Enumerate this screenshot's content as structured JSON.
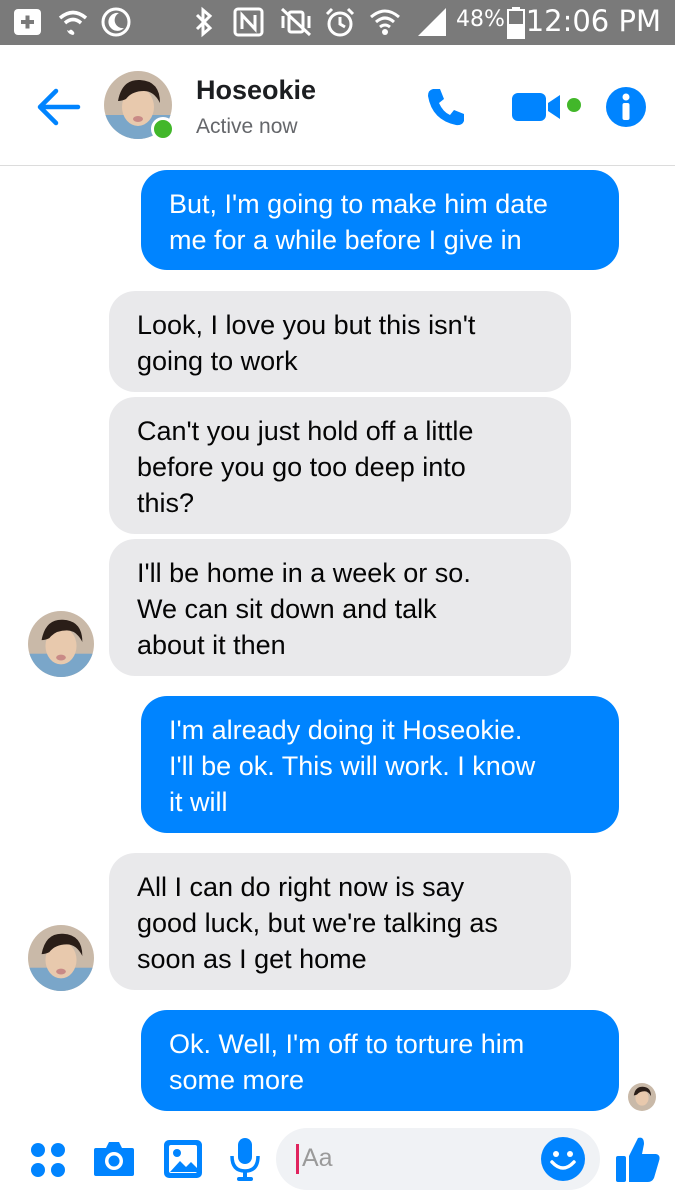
{
  "status_bar": {
    "battery": "48%",
    "time": "12:06 PM",
    "icons": [
      "add-icon",
      "wifi-calling-icon",
      "do-not-disturb-icon",
      "bluetooth-icon",
      "nfc-icon",
      "vibrate-mute-icon",
      "alarm-icon",
      "wifi-icon",
      "signal-icon",
      "battery-icon"
    ]
  },
  "header": {
    "contact_name": "Hoseokie",
    "contact_status": "Active now",
    "icons": [
      "back-arrow-icon",
      "phone-icon",
      "video-camera-icon",
      "info-icon"
    ]
  },
  "messages": [
    {
      "sender": "me",
      "text": "But, I'm going to make him date\nme for a while before I give in"
    },
    {
      "sender": "them",
      "text": "Look, I love you but this isn't\ngoing to work"
    },
    {
      "sender": "them",
      "text": "Can't you just hold off a little\nbefore you go too deep into\nthis?"
    },
    {
      "sender": "them",
      "text": "I'll be home in a week or so.\nWe can sit down and talk\nabout it then"
    },
    {
      "sender": "me",
      "text": "I'm already doing it Hoseokie.\nI'll be ok. This will work. I know\nit will"
    },
    {
      "sender": "them",
      "text": "All I can do right now is say\ngood luck, but we're talking as\nsoon as I get home"
    },
    {
      "sender": "me",
      "text": "Ok. Well, I'm off to torture him\nsome more"
    }
  ],
  "composer": {
    "placeholder": "Aa",
    "icons": [
      "more-options-icon",
      "camera-icon",
      "gallery-icon",
      "microphone-icon",
      "emoji-icon",
      "thumbs-up-icon"
    ]
  },
  "colors": {
    "accent": "#0084ff",
    "status_bar_bg": "#7a7a7a",
    "incoming_bubble": "#e9e9eb",
    "online": "#42b72a"
  }
}
